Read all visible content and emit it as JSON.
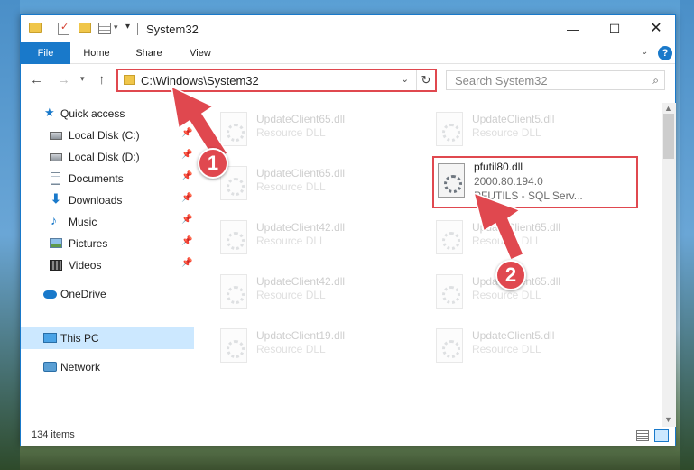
{
  "window": {
    "title": "System32",
    "controls": {
      "minimize": "—",
      "maximize": "☐",
      "close": "✕"
    }
  },
  "ribbon": {
    "tabs": [
      "File",
      "Home",
      "Share",
      "View"
    ],
    "help": "?"
  },
  "nav": {
    "address": "C:\\Windows\\System32",
    "search_placeholder": "Search System32"
  },
  "sidebar": {
    "items": [
      {
        "label": "Quick access",
        "icon": "star-icon",
        "pinned": false
      },
      {
        "label": "Local Disk (C:)",
        "icon": "disk-icon",
        "pinned": true
      },
      {
        "label": "Local Disk (D:)",
        "icon": "disk-icon",
        "pinned": true
      },
      {
        "label": "Documents",
        "icon": "documents-icon",
        "pinned": true
      },
      {
        "label": "Downloads",
        "icon": "downloads-icon",
        "pinned": true
      },
      {
        "label": "Music",
        "icon": "music-icon",
        "pinned": true
      },
      {
        "label": "Pictures",
        "icon": "pictures-icon",
        "pinned": true
      },
      {
        "label": "Videos",
        "icon": "videos-icon",
        "pinned": true
      },
      {
        "label": "OneDrive",
        "icon": "cloud-icon",
        "pinned": false
      },
      {
        "label": "This PC",
        "icon": "pc-icon",
        "pinned": false,
        "selected": true
      },
      {
        "label": "Network",
        "icon": "network-icon",
        "pinned": false
      }
    ]
  },
  "files": [
    {
      "name": "UpdateClient65.dll",
      "line2": "Resource DLL",
      "faded": true
    },
    {
      "name": "UpdateClient5.dll",
      "line2": "Resource DLL",
      "faded": true
    },
    {
      "name": "UpdateClient65.dll",
      "line2": "Resource DLL",
      "faded": true
    },
    {
      "name": "pfutil80.dll",
      "line2": "2000.80.194.0",
      "line3": "PFUTILS - SQL Serv...",
      "faded": false,
      "highlighted": true
    },
    {
      "name": "UpdateClient42.dll",
      "line2": "Resource DLL",
      "faded": true
    },
    {
      "name": "UpdateClient65.dll",
      "line2": "Resource DLL",
      "faded": true
    },
    {
      "name": "UpdateClient42.dll",
      "line2": "Resource DLL",
      "faded": true
    },
    {
      "name": "UpdateClient65.dll",
      "line2": "Resource DLL",
      "faded": true
    },
    {
      "name": "UpdateClient19.dll",
      "line2": "Resource DLL",
      "faded": true
    },
    {
      "name": "UpdateClient5.dll",
      "line2": "Resource DLL",
      "faded": true
    }
  ],
  "status": {
    "count": "134 items"
  },
  "annotations": {
    "step1": "1",
    "step2": "2",
    "color": "#e0484f"
  }
}
